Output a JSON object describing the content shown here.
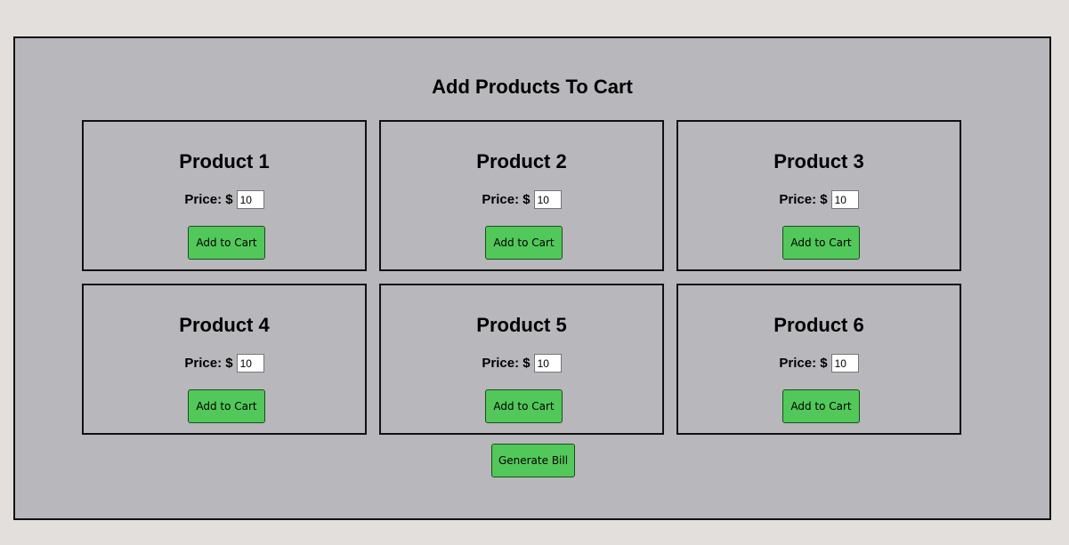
{
  "page": {
    "title": "Add Products To Cart"
  },
  "products": [
    {
      "name": "Product 1",
      "price_label": "Price: $",
      "price_value": "10",
      "button_label": "Add to Cart"
    },
    {
      "name": "Product 2",
      "price_label": "Price: $",
      "price_value": "10",
      "button_label": "Add to Cart"
    },
    {
      "name": "Product 3",
      "price_label": "Price: $",
      "price_value": "10",
      "button_label": "Add to Cart"
    },
    {
      "name": "Product 4",
      "price_label": "Price: $",
      "price_value": "10",
      "button_label": "Add to Cart"
    },
    {
      "name": "Product 5",
      "price_label": "Price: $",
      "price_value": "10",
      "button_label": "Add to Cart"
    },
    {
      "name": "Product 6",
      "price_label": "Price: $",
      "price_value": "10",
      "button_label": "Add to Cart"
    }
  ],
  "actions": {
    "generate_bill_label": "Generate Bill"
  },
  "colors": {
    "page_background": "#e2dfdd",
    "panel_background": "#b8b7bc",
    "button_green": "#52c85a"
  }
}
